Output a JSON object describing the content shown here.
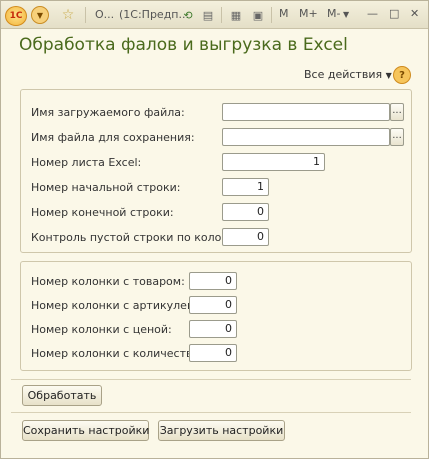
{
  "titlebar": {
    "logo": "1С",
    "tab_title": "О...",
    "app_title": "(1С:Предп...",
    "toolbar_icons": [
      "back-arrow-icon",
      "doc-icon",
      "calculator-icon",
      "calendar-icon"
    ],
    "memory": [
      "M",
      "M+",
      "M-"
    ],
    "window_controls": {
      "min": "—",
      "max": "□",
      "close": "✕"
    }
  },
  "form": {
    "title": "Обработка фалов и выгрузка в Excel",
    "all_actions": "Все действия",
    "help": "?"
  },
  "group1": {
    "rows": [
      {
        "label": "Имя загружаемого файла:",
        "value": ""
      },
      {
        "label": "Имя файла для сохранения:",
        "value": ""
      },
      {
        "label": "Номер листа Excel:",
        "value": "1"
      },
      {
        "label": "Номер начальной строки:",
        "value": "1"
      },
      {
        "label": "Номер конечной строки:",
        "value": "0"
      },
      {
        "label": "Контроль пустой строки по колонке:",
        "value": "0"
      }
    ]
  },
  "group2": {
    "rows": [
      {
        "label": "Номер колонки с товаром:",
        "value": "0"
      },
      {
        "label": "Номер колонки с артикулем:",
        "value": "0"
      },
      {
        "label": "Номер колонки с ценой:",
        "value": "0"
      },
      {
        "label": "Номер колонки с количеством:",
        "value": "0"
      }
    ]
  },
  "buttons": {
    "process": "Обработать",
    "save_settings": "Сохранить настройки",
    "load_settings": "Загрузить настройки"
  }
}
